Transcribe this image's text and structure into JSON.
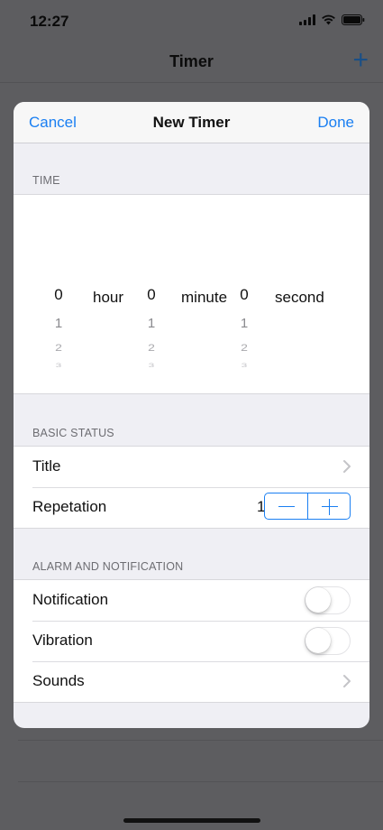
{
  "status_bar": {
    "time": "12:27"
  },
  "background_screen": {
    "title": "Timer",
    "add_icon": "plus-icon"
  },
  "sheet": {
    "nav": {
      "cancel_label": "Cancel",
      "title": "New Timer",
      "done_label": "Done"
    },
    "time_section": {
      "header": "TIME",
      "picker": {
        "columns": [
          {
            "unit_label": "hour",
            "values": [
              "0",
              "1",
              "2",
              "3"
            ]
          },
          {
            "unit_label": "minute",
            "values": [
              "0",
              "1",
              "2",
              "3"
            ]
          },
          {
            "unit_label": "second",
            "values": [
              "0",
              "1",
              "2",
              "3"
            ]
          }
        ]
      }
    },
    "basic_status": {
      "header": "BASIC STATUS",
      "title_label": "Title",
      "repetation_label": "Repetation",
      "repetation_value": "1"
    },
    "alarm_section": {
      "header": "ALARM AND NOTIFICATION",
      "notification_label": "Notification",
      "notification_on": false,
      "vibration_label": "Vibration",
      "vibration_on": false,
      "sounds_label": "Sounds"
    }
  },
  "colors": {
    "accent": "#1a7ff2",
    "sheet_background": "#efeff4",
    "dim_background": "#5d5d60"
  }
}
